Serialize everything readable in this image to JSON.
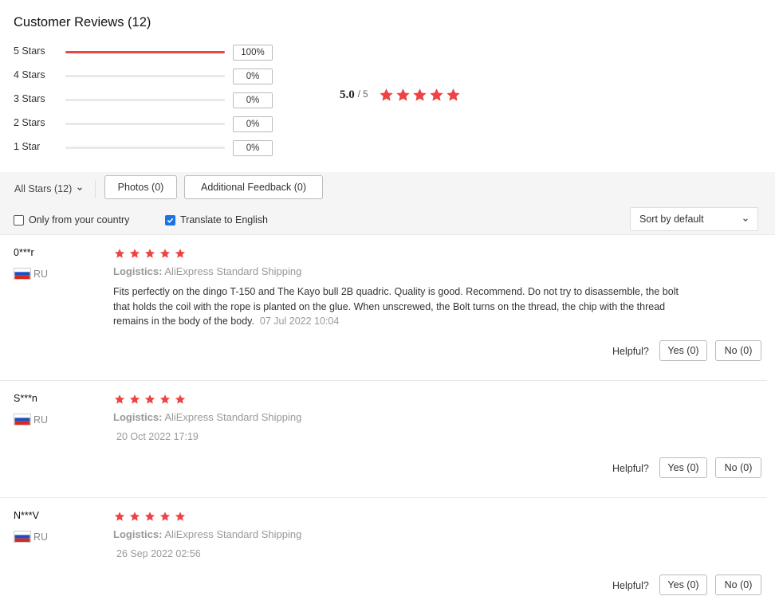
{
  "header": {
    "title": "Customer Reviews (12)"
  },
  "distribution": [
    {
      "label": "5 Stars",
      "pct_text": "100%",
      "fraction": 1.0
    },
    {
      "label": "4 Stars",
      "pct_text": "0%",
      "fraction": 0
    },
    {
      "label": "3 Stars",
      "pct_text": "0%",
      "fraction": 0
    },
    {
      "label": "2 Stars",
      "pct_text": "0%",
      "fraction": 0
    },
    {
      "label": "1 Star",
      "pct_text": "0%",
      "fraction": 0
    }
  ],
  "summary": {
    "score": "5.0",
    "out_of": "/ 5",
    "stars": 5
  },
  "filters": {
    "all_stars": "All Stars (12)",
    "photos": "Photos (0)",
    "additional_feedback": "Additional Feedback (0)",
    "only_country": "Only from your country",
    "only_country_checked": false,
    "translate": "Translate to English",
    "translate_checked": true,
    "sort": "Sort by default"
  },
  "labels": {
    "logistics": "Logistics:",
    "helpful": "Helpful?"
  },
  "colors": {
    "accent": "#ee4343",
    "star": "#ee4343",
    "checkbox": "#1a73e8"
  },
  "reviews": [
    {
      "user": "0***r",
      "country": "RU",
      "stars": 5,
      "shipping": "AliExpress Standard Shipping",
      "text": "Fits perfectly on the dingo T-150 and The Kayo bull 2B quadric. Quality is good. Recommend. Do not try to disassemble, the bolt that holds the coil with the rope is planted on the glue. When unscrewed, the Bolt turns on the thread, the chip with the thread remains in the body of the body.",
      "date": "07 Jul 2022 10:04",
      "yes": "Yes (0)",
      "no": "No (0)"
    },
    {
      "user": "S***n",
      "country": "RU",
      "stars": 5,
      "shipping": "AliExpress Standard Shipping",
      "text": "",
      "date": "20 Oct 2022 17:19",
      "yes": "Yes (0)",
      "no": "No (0)"
    },
    {
      "user": "N***V",
      "country": "RU",
      "stars": 5,
      "shipping": "AliExpress Standard Shipping",
      "text": "",
      "date": "26 Sep 2022 02:56",
      "yes": "Yes (0)",
      "no": "No (0)"
    }
  ]
}
